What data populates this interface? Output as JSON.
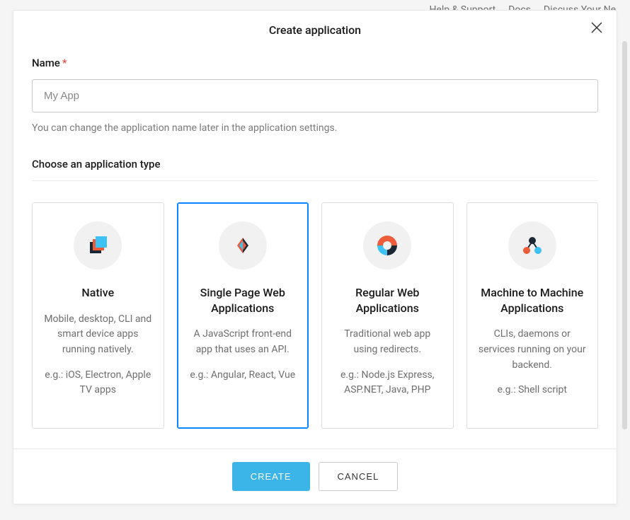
{
  "backdrop": {
    "help": "Help & Support",
    "docs": "Docs",
    "discuss": "Discuss Your Ne"
  },
  "modal": {
    "title": "Create application",
    "name_label": "Name",
    "name_placeholder": "My App",
    "name_helper": "You can change the application name later in the application settings.",
    "type_section_title": "Choose an application type"
  },
  "types": [
    {
      "title": "Native",
      "desc": "Mobile, desktop, CLI and smart device apps running natively.",
      "eg": "e.g.: iOS, Electron, Apple TV apps",
      "selected": false
    },
    {
      "title": "Single Page Web Applications",
      "desc": "A JavaScript front-end app that uses an API.",
      "eg": "e.g.: Angular, React, Vue",
      "selected": true
    },
    {
      "title": "Regular Web Applications",
      "desc": "Traditional web app using redirects.",
      "eg": "e.g.: Node.js Express, ASP.NET, Java, PHP",
      "selected": false
    },
    {
      "title": "Machine to Machine Applications",
      "desc": "CLIs, daemons or services running on your backend.",
      "eg": "e.g.: Shell script",
      "selected": false
    }
  ],
  "footer": {
    "create": "CREATE",
    "cancel": "CANCEL"
  }
}
